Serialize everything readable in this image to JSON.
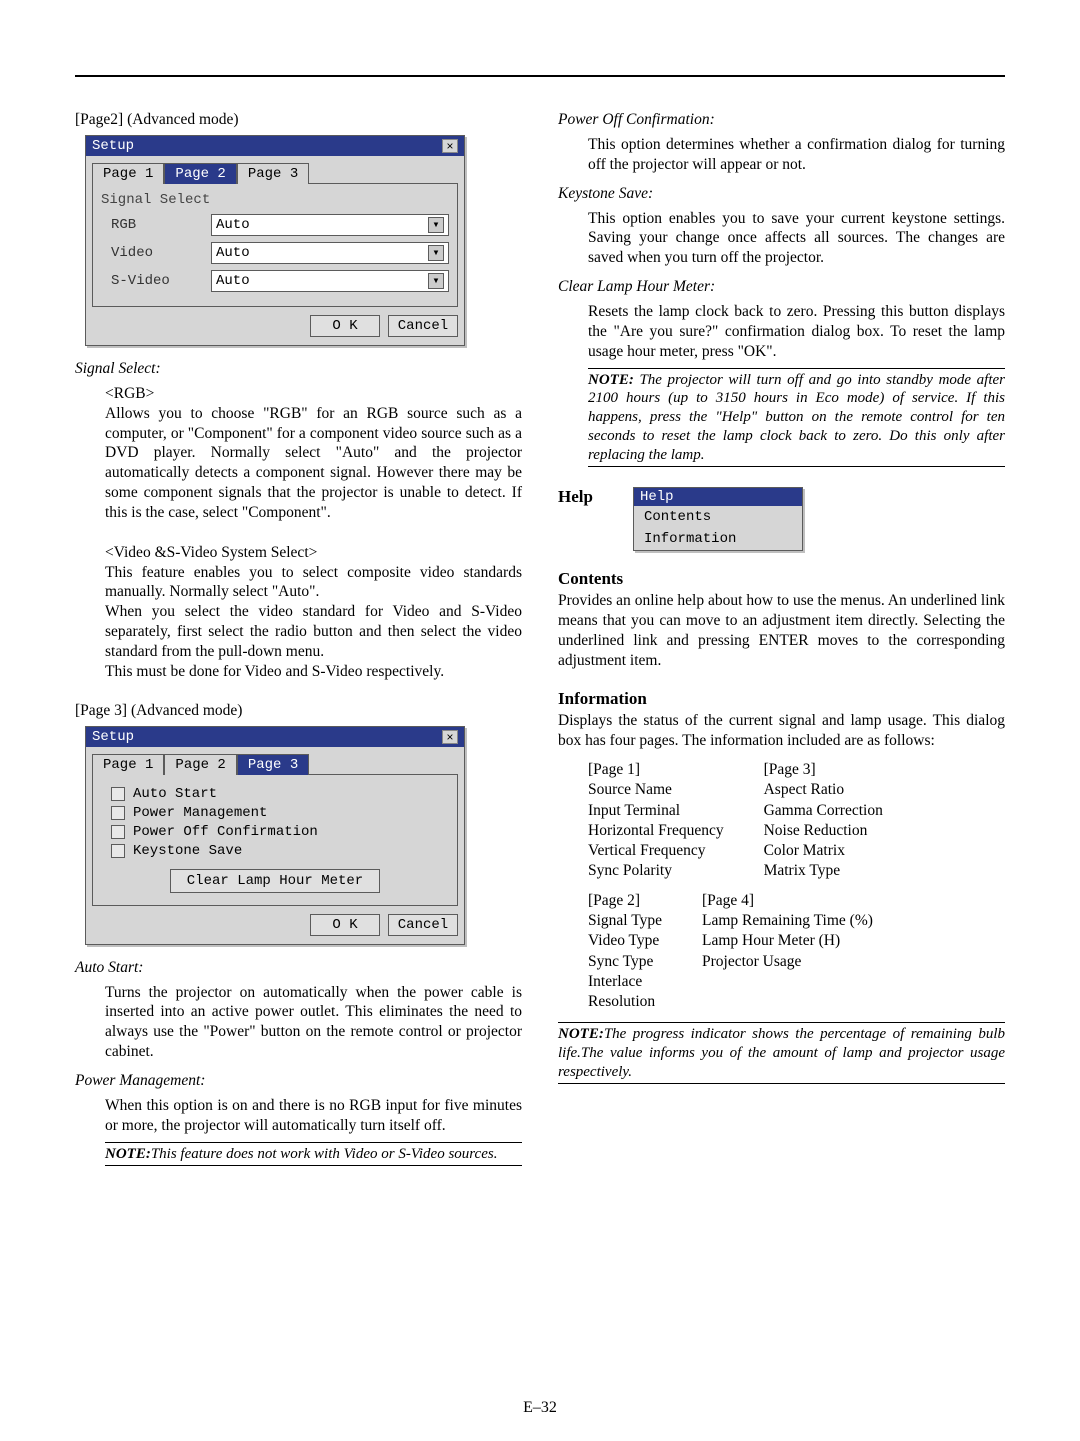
{
  "page_number": "E–32",
  "left": {
    "page2_header": "[Page2] (Advanced mode)",
    "setup_panel_title": "Setup",
    "tabs": {
      "p1": "Page 1",
      "p2": "Page 2",
      "p3": "Page 3"
    },
    "signal_select_group": "Signal Select",
    "rows": {
      "rgb": {
        "label": "RGB",
        "value": "Auto"
      },
      "video": {
        "label": "Video",
        "value": "Auto"
      },
      "svideo": {
        "label": "S-Video",
        "value": "Auto"
      }
    },
    "ok_btn": "O K",
    "cancel_btn": "Cancel",
    "signal_select_hdr": "Signal Select:",
    "rgb_hdr": "<RGB>",
    "rgb_body": "Allows you to choose \"RGB\" for an RGB source such as a computer, or \"Component\" for a component video source such as a DVD player. Normally select \"Auto\" and the projector automatically detects a component signal. However there may be some component signals that the projector is unable to detect. If this is the case, select \"Component\".",
    "vs_hdr": "<Video &S-Video System Select>",
    "vs_body1": "This feature enables you to select composite video standards manually. Normally select \"Auto\".",
    "vs_body2": "When you select the video standard for Video and S-Video separately, first select the radio button and then select the video standard from the pull-down menu.",
    "vs_body3": "This must be done for Video and S-Video respectively.",
    "page3_header": "[Page 3] (Advanced mode)",
    "checks": {
      "auto_start": "Auto Start",
      "power_mgmt": "Power Management",
      "power_off_conf": "Power Off Confirmation",
      "keystone_save": "Keystone Save"
    },
    "clear_lamp_btn": "Clear Lamp Hour Meter",
    "auto_start_hdr": "Auto Start:",
    "auto_start_body": "Turns the projector on automatically when the power cable is inserted into an active power outlet. This eliminates the need to always use the \"Power\" button on the remote control or projector cabinet.",
    "power_mgmt_hdr": "Power Management:",
    "power_mgmt_body": "When this option is on and there is no RGB input for five minutes or more, the projector will automatically turn itself off.",
    "note1_label": "NOTE:",
    "note1_body": "This feature does not work with Video or S-Video sources."
  },
  "right": {
    "power_off_hdr": "Power Off Confirmation:",
    "power_off_body": "This option determines whether a confirmation dialog for turning off the projector will appear or not.",
    "keystone_hdr": "Keystone Save:",
    "keystone_body": "This option enables you to save your current keystone settings. Saving your change once affects all sources. The changes are saved when you turn off the projector.",
    "clear_lamp_hdr": "Clear Lamp Hour Meter:",
    "clear_lamp_body": "Resets the lamp clock back to zero. Pressing this button displays the \"Are you sure?\" confirmation dialog box. To reset the lamp usage hour meter, press \"OK\".",
    "note2_label": "NOTE:",
    "note2_body": " The projector will turn off and go into standby mode after 2100 hours (up to 3150 hours in Eco mode) of service. If this happens, press the \"Help\" button on the remote control for ten seconds to reset the lamp clock back to zero. Do this only after replacing the lamp.",
    "help_label": "Help",
    "help_items": {
      "title": "Help",
      "contents": "Contents",
      "info": "Information"
    },
    "contents_hdr": "Contents",
    "contents_body": "Provides an online help about how to use the menus. An underlined link means that you can move to an adjustment item directly. Selecting the underlined link and pressing ENTER moves to the corresponding adjustment item.",
    "info_hdr": "Information",
    "info_body": "Displays the status of the current signal and lamp usage. This dialog box has four pages. The information included are as follows:",
    "info_p1_hdr": "[Page 1]",
    "info_p1": [
      "Source Name",
      "Input Terminal",
      "Horizontal Frequency",
      "Vertical Frequency",
      "Sync Polarity"
    ],
    "info_p3_hdr": "[Page 3]",
    "info_p3": [
      "Aspect Ratio",
      "Gamma Correction",
      "Noise Reduction",
      "Color Matrix",
      "Matrix Type"
    ],
    "info_p2_hdr": "[Page 2]",
    "info_p2": [
      "Signal Type",
      "Video Type",
      "Sync Type",
      "Interlace",
      "Resolution"
    ],
    "info_p4_hdr": "[Page 4]",
    "info_p4": [
      "Lamp Remaining Time (%)",
      "Lamp Hour Meter (H)",
      "Projector Usage"
    ],
    "note3_label": "NOTE:",
    "note3_body": "The progress indicator shows the percentage of remaining bulb life.The value informs you of the amount of lamp and projector usage respectively."
  }
}
